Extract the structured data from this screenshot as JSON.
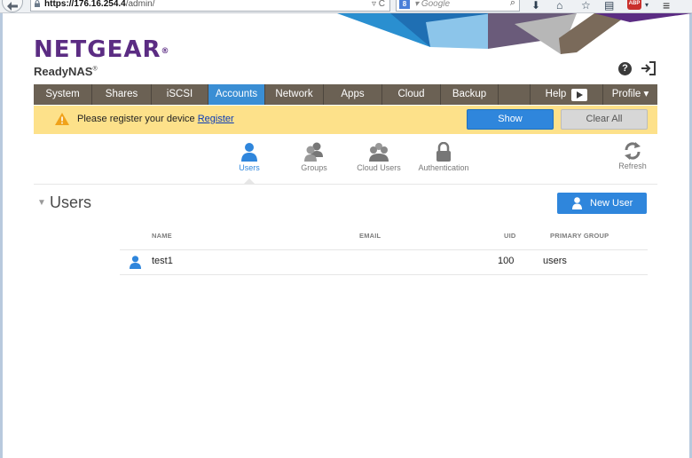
{
  "browser": {
    "url_host": "https://176.16.254.4",
    "url_path": "/admin/",
    "search_placeholder": "Google",
    "search_engine_letter": "8",
    "addon_label": "ABP"
  },
  "brand": {
    "logo": "NETGEAR",
    "logo_mark": "®",
    "product": "ReadyNAS",
    "product_mark": "®",
    "purple": "#5b2c83"
  },
  "nav": {
    "items": [
      {
        "label": "System",
        "active": false
      },
      {
        "label": "Shares",
        "active": false
      },
      {
        "label": "iSCSI",
        "active": false
      },
      {
        "label": "Accounts",
        "active": true
      },
      {
        "label": "Network",
        "active": false
      },
      {
        "label": "Apps",
        "active": false
      },
      {
        "label": "Cloud",
        "active": false
      },
      {
        "label": "Backup",
        "active": false
      }
    ],
    "help": "Help",
    "profile": "Profile ▾",
    "active_color": "#3a8ed4"
  },
  "notice": {
    "text": "Please register your device ",
    "link": "Register",
    "show_button": "Show",
    "clear_button": "Clear All"
  },
  "subtabs": {
    "users": "Users",
    "groups": "Groups",
    "cloud_users": "Cloud Users",
    "authentication": "Authentication",
    "refresh": "Refresh"
  },
  "users_section": {
    "title": "Users",
    "toggle": "▼",
    "new_user_button": "New User",
    "columns": {
      "name": "NAME",
      "email": "EMAIL",
      "uid": "UID",
      "primary_group": "PRIMARY GROUP"
    },
    "rows": [
      {
        "name": "test1",
        "email": "",
        "uid": "100",
        "primary_group": "users"
      }
    ]
  }
}
